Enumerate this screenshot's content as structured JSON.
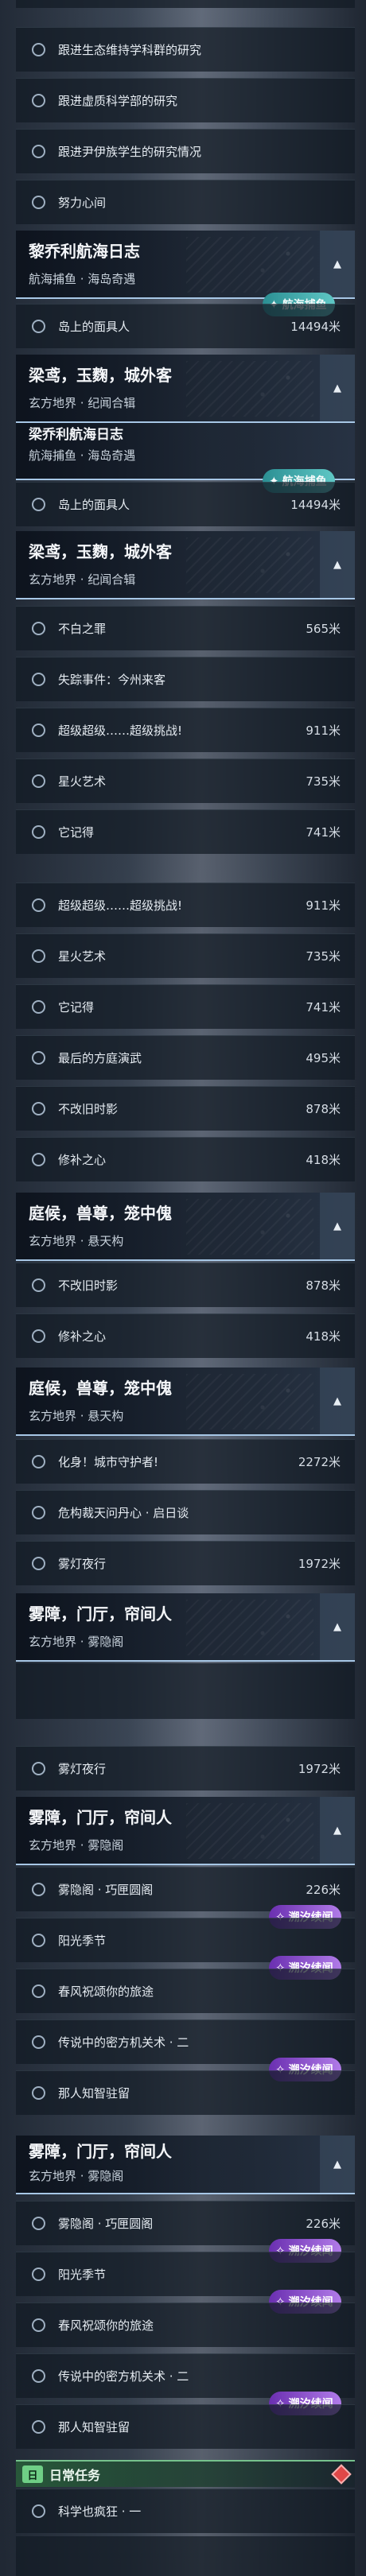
{
  "tasks": {
    "r0": {
      "label": "跟进生态维持学科群的研究",
      "dist": ""
    },
    "r1": {
      "label": "跟进虚质科学部的研究",
      "dist": ""
    },
    "r2": {
      "label": "跟进尹伊族学生的研究情况",
      "dist": ""
    },
    "r3": {
      "label": "努力心间",
      "dist": ""
    },
    "r4": {
      "label": "岛上的面具人",
      "dist": "14494米"
    },
    "r5": {
      "label": "岛上的面具人",
      "dist": "14494米"
    },
    "r6": {
      "label": "不白之罪",
      "dist": "565米"
    },
    "r7": {
      "label": "失踪事件：今州来客",
      "dist": ""
    },
    "r8": {
      "label": "超级超级……超级挑战!",
      "dist": "911米"
    },
    "r9": {
      "label": "星火艺术",
      "dist": "735米"
    },
    "r10": {
      "label": "它记得",
      "dist": "741米"
    },
    "r11": {
      "label": "超级超级……超级挑战!",
      "dist": "911米"
    },
    "r12": {
      "label": "星火艺术",
      "dist": "735米"
    },
    "r13": {
      "label": "它记得",
      "dist": "741米"
    },
    "r14": {
      "label": "最后的方庭演武",
      "dist": "495米"
    },
    "r15": {
      "label": "不改旧时影",
      "dist": "878米"
    },
    "r16": {
      "label": "修补之心",
      "dist": "418米"
    },
    "r17": {
      "label": "不改旧时影",
      "dist": "878米"
    },
    "r18": {
      "label": "修补之心",
      "dist": "418米"
    },
    "r19": {
      "label": "化身！城市守护者!",
      "dist": "2272米"
    },
    "r20": {
      "label": "危构裁天问丹心 · 启日谈",
      "dist": ""
    },
    "r21": {
      "label": "雾灯夜行",
      "dist": "1972米"
    },
    "r22": {
      "label": "雾灯夜行",
      "dist": "1972米"
    },
    "r23": {
      "label": "雾隐阁 · 巧匣圆阁",
      "dist": "226米"
    },
    "r24": {
      "label": "阳光季节",
      "dist": ""
    },
    "r25": {
      "label": "春风祝颂你的旅途",
      "dist": ""
    },
    "r26": {
      "label": "传说中的密方机关术 · 二",
      "dist": ""
    },
    "r27": {
      "label": "那人知智驻留",
      "dist": ""
    },
    "r28": {
      "label": "雾隐阁 · 巧匣圆阁",
      "dist": "226米"
    },
    "r29": {
      "label": "阳光季节",
      "dist": ""
    },
    "r30": {
      "label": "春风祝颂你的旅途",
      "dist": ""
    },
    "r31": {
      "label": "传说中的密方机关术 · 二",
      "dist": ""
    },
    "r32": {
      "label": "那人知智驻留",
      "dist": ""
    },
    "r33": {
      "label": "科学也疯狂 · 一",
      "dist": ""
    }
  },
  "headers": {
    "h1": {
      "title": "黎乔利航海日志",
      "sub": "航海捕鱼 · 海岛奇遇"
    },
    "h2": {
      "title": "梁鸢，玉麴，城外客",
      "sub": "玄方地界 · 纪闻合辑"
    },
    "h3": {
      "title": "梁鸢，玉麴，城外客",
      "sub": "玄方地界 · 纪闻合辑"
    },
    "h4": {
      "title": "庭候，兽尊，笼中傀",
      "sub": "玄方地界 · 悬天构"
    },
    "h5": {
      "title": "庭候，兽尊，笼中傀",
      "sub": "玄方地界 · 悬天构"
    },
    "h6": {
      "title": "雾障，门厅，帘间人",
      "sub": "玄方地界 · 雾隐阁"
    },
    "h7": {
      "title": "雾障，门厅，帘间人",
      "sub": "玄方地界 · 雾隐阁"
    },
    "h8": {
      "title": "雾障，门厅，帘间人",
      "sub": "玄方地界 · 雾隐阁"
    }
  },
  "partial_headers": {
    "p1": "梁乔利航海日志",
    "p1sub": "航海捕鱼 · 海岛奇遇"
  },
  "badges": {
    "green": "航海捕鱼",
    "purple": "溯汐续闻"
  },
  "daily": {
    "label": "日常任务",
    "icon": "日"
  },
  "colors": {
    "accent": "#a7c7e6",
    "daily": "#76c28d",
    "badge_green": "#3aa6a8",
    "badge_purple": "#8b4fd0"
  }
}
